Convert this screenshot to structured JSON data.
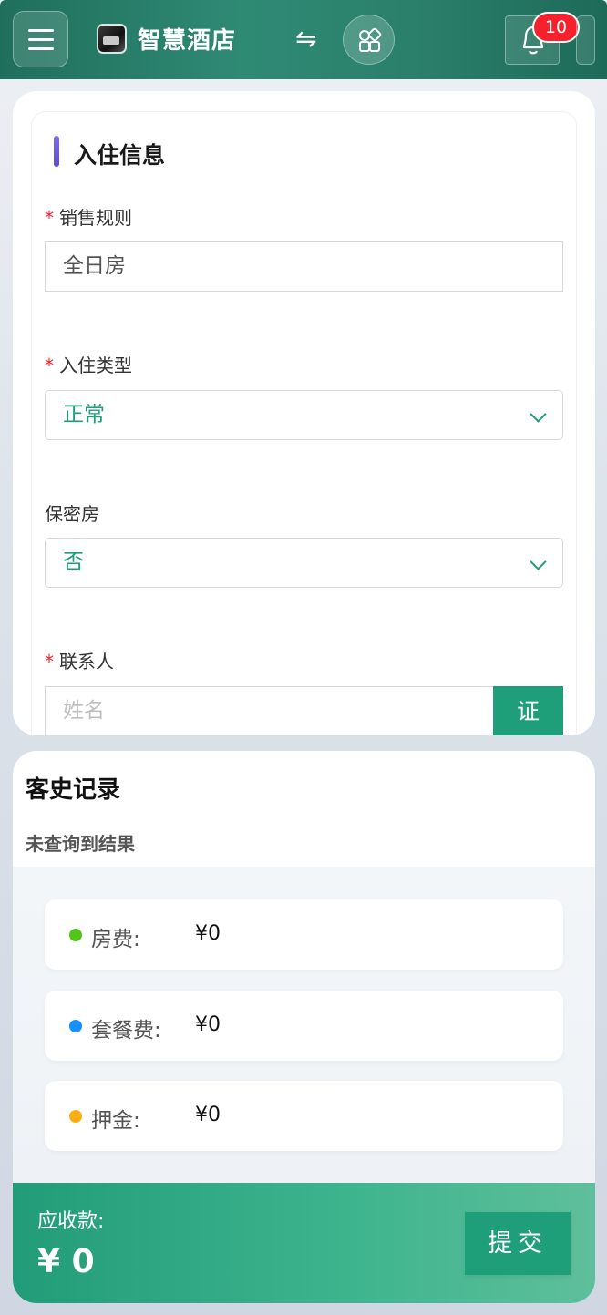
{
  "header": {
    "app_title": "智慧酒店",
    "notification_count": "10"
  },
  "checkin": {
    "section_title": "入住信息",
    "sales_rule_label": "销售规则",
    "sales_rule_value": "全日房",
    "checkin_type_label": "入住类型",
    "checkin_type_value": "正常",
    "confidential_label": "保密房",
    "confidential_value": "否",
    "contact_label": "联系人",
    "contact_placeholder": "姓名",
    "cert_button": "证"
  },
  "history": {
    "title": "客史记录",
    "empty_text": "未查询到结果"
  },
  "fees": [
    {
      "label": "房费:",
      "value": "¥0",
      "color": "#52c41a"
    },
    {
      "label": "套餐费:",
      "value": "¥0",
      "color": "#1890ff"
    },
    {
      "label": "押金:",
      "value": "¥0",
      "color": "#faad14"
    }
  ],
  "total": {
    "label": "应收款:",
    "amount": "¥ 0",
    "submit_label": "提交"
  },
  "colors": {
    "accent": "#1f9e7a",
    "required": "#f5222d",
    "badge": "#f5222d"
  }
}
